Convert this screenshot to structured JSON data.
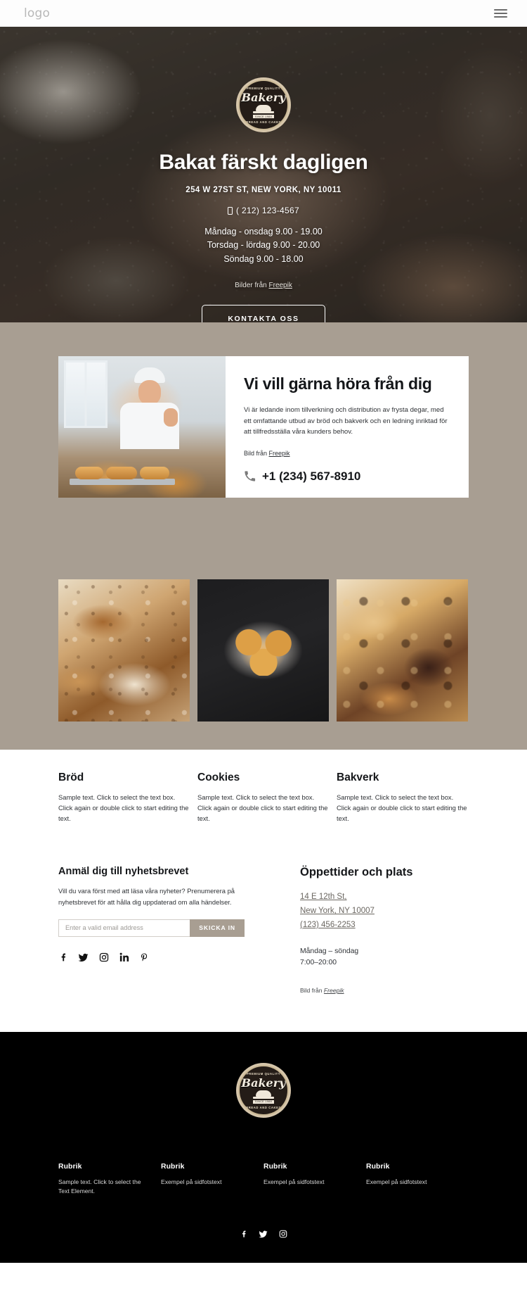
{
  "header": {
    "logo_text": "logo",
    "menu_icon": "hamburger-menu-icon"
  },
  "hero": {
    "badge": {
      "top_text": "PREMIUM QUALITY",
      "name": "Bakery",
      "since": "SINCE 1988",
      "bottom_text": "BREAD AND CAKES"
    },
    "title": "Bakat färskt dagligen",
    "address": "254 W 27ST ST, NEW YORK, NY 10011",
    "phone": "( 212) 123-4567",
    "hours": [
      "Måndag - onsdag 9.00 - 19.00",
      "Torsdag - lördag 9.00 - 20.00",
      "Söndag 9.00 - 18.00"
    ],
    "credit_prefix": "Bilder från ",
    "credit_link": "Freepik",
    "cta_label": "KONTAKTA OSS"
  },
  "contact": {
    "title": "Vi vill gärna höra från dig",
    "paragraph": "Vi är ledande inom tillverkning och distribution av frysta degar, med ett omfattande utbud av bröd och bakverk och en ledning inriktad för att tillfredsställa våra kunders behov.",
    "credit_prefix": "Bild från ",
    "credit_link": "Freepik",
    "phone": "+1 (234) 567-8910",
    "phone_icon": "phone-icon"
  },
  "products": [
    {
      "title": "Bröd",
      "text": "Sample text. Click to select the text box. Click again or double click to start editing the text.",
      "image": "bread-photo"
    },
    {
      "title": "Cookies",
      "text": "Sample text. Click to select the text box. Click again or double click to start editing the text.",
      "image": "cinnamon-buns-photo"
    },
    {
      "title": "Bakverk",
      "text": "Sample text. Click to select the text box. Click again or double click to start editing the text.",
      "image": "pastries-photo"
    }
  ],
  "newsletter": {
    "title": "Anmäl dig till nyhetsbrevet",
    "text": "Vill du vara först med att läsa våra nyheter? Prenumerera på nyhetsbrevet för att hålla dig uppdaterad om alla händelser.",
    "placeholder": "Enter a valid email address",
    "value": "",
    "button_label": "SKICKA IN",
    "socials": [
      "facebook-icon",
      "twitter-icon",
      "instagram-icon",
      "linkedin-icon",
      "pinterest-icon"
    ]
  },
  "location": {
    "title": "Öppettider och plats",
    "address_line1": "14 E 12th St,",
    "address_line2": "New York, NY 10007",
    "phone": "(123) 456-2253",
    "hours_days": "Måndag – söndag",
    "hours_time": "7:00–20:00",
    "credit_prefix": "Bild från ",
    "credit_link": "Freepik"
  },
  "footer": {
    "badge": {
      "top_text": "PREMIUM QUALITY",
      "name": "Bakery",
      "since": "SINCE 1988",
      "bottom_text": "BREAD AND CAKES"
    },
    "columns": [
      {
        "title": "Rubrik",
        "text": "Sample text. Click to select the Text Element."
      },
      {
        "title": "Rubrik",
        "text": "Exempel på sidfotstext"
      },
      {
        "title": "Rubrik",
        "text": "Exempel på sidfotstext"
      },
      {
        "title": "Rubrik",
        "text": "Exempel på sidfotstext"
      }
    ],
    "socials": [
      "facebook-icon",
      "twitter-icon",
      "instagram-icon"
    ]
  },
  "colors": {
    "taupe": "#a89e92",
    "footer_bg": "#000000",
    "badge_gold": "#d6c6ab"
  }
}
